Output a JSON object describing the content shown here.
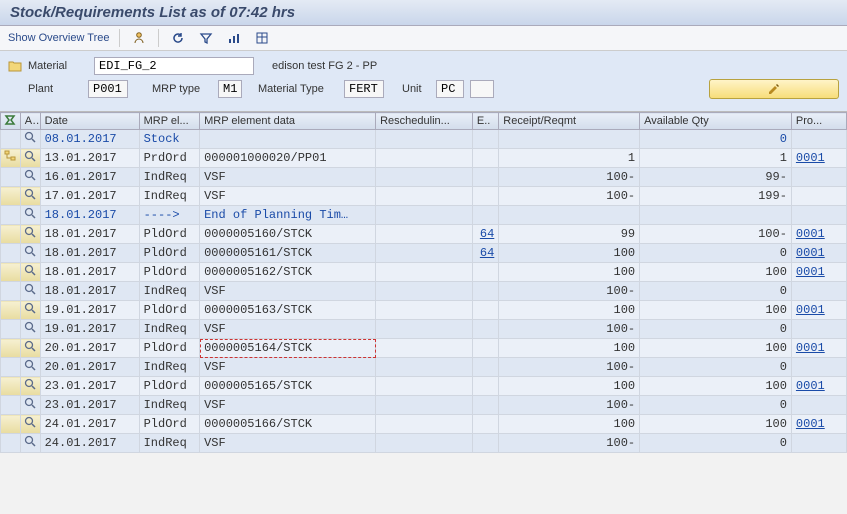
{
  "title": "Stock/Requirements List as of 07:42 hrs",
  "toolbar": {
    "overview": "Show Overview Tree"
  },
  "header": {
    "material_label": "Material",
    "material_value": "EDI_FG_2",
    "material_desc": "edison test FG 2 - PP",
    "plant_label": "Plant",
    "plant_value": "P001",
    "mrp_type_label": "MRP type",
    "mrp_type_value": "M1",
    "mat_type_label": "Material Type",
    "mat_type_value": "FERT",
    "unit_label": "Unit",
    "unit_value": "PC"
  },
  "columns": {
    "side": "",
    "act": "A..",
    "date": "Date",
    "el": "MRP el...",
    "eldata": "MRP element data",
    "res": "Reschedulin...",
    "e": "E..",
    "rec": "Receipt/Reqmt",
    "avail": "Available Qty",
    "pro": "Pro..."
  },
  "rows": [
    {
      "date": "08.01.2017",
      "el": "Stock",
      "eldata": "",
      "res": "",
      "e": "",
      "rec": "",
      "avail": "0",
      "pro": "",
      "blue": true
    },
    {
      "date": "13.01.2017",
      "el": "PrdOrd",
      "eldata": "000001000020/PP01",
      "res": "",
      "e": "",
      "rec": "1",
      "avail": "1",
      "pro": "0001",
      "elink": false
    },
    {
      "date": "16.01.2017",
      "el": "IndReq",
      "eldata": "VSF",
      "res": "",
      "e": "",
      "rec": "100-",
      "avail": "99-",
      "pro": ""
    },
    {
      "date": "17.01.2017",
      "el": "IndReq",
      "eldata": "VSF",
      "res": "",
      "e": "",
      "rec": "100-",
      "avail": "199-",
      "pro": ""
    },
    {
      "date": "18.01.2017",
      "el": "---->",
      "eldata": "End of Planning Tim…",
      "res": "",
      "e": "",
      "rec": "",
      "avail": "",
      "pro": "",
      "blue": true
    },
    {
      "date": "18.01.2017",
      "el": "PldOrd",
      "eldata": "0000005160/STCK",
      "res": "",
      "e": "64",
      "rec": "99",
      "avail": "100-",
      "pro": "0001",
      "elink": true
    },
    {
      "date": "18.01.2017",
      "el": "PldOrd",
      "eldata": "0000005161/STCK",
      "res": "",
      "e": "64",
      "rec": "100",
      "avail": "0",
      "pro": "0001",
      "elink": true
    },
    {
      "date": "18.01.2017",
      "el": "PldOrd",
      "eldata": "0000005162/STCK",
      "res": "",
      "e": "",
      "rec": "100",
      "avail": "100",
      "pro": "0001"
    },
    {
      "date": "18.01.2017",
      "el": "IndReq",
      "eldata": "VSF",
      "res": "",
      "e": "",
      "rec": "100-",
      "avail": "0",
      "pro": ""
    },
    {
      "date": "19.01.2017",
      "el": "PldOrd",
      "eldata": "0000005163/STCK",
      "res": "",
      "e": "",
      "rec": "100",
      "avail": "100",
      "pro": "0001"
    },
    {
      "date": "19.01.2017",
      "el": "IndReq",
      "eldata": "VSF",
      "res": "",
      "e": "",
      "rec": "100-",
      "avail": "0",
      "pro": ""
    },
    {
      "date": "20.01.2017",
      "el": "PldOrd",
      "eldata": "0000005164/STCK",
      "res": "",
      "e": "",
      "rec": "100",
      "avail": "100",
      "pro": "0001",
      "selected": true
    },
    {
      "date": "20.01.2017",
      "el": "IndReq",
      "eldata": "VSF",
      "res": "",
      "e": "",
      "rec": "100-",
      "avail": "0",
      "pro": ""
    },
    {
      "date": "23.01.2017",
      "el": "PldOrd",
      "eldata": "0000005165/STCK",
      "res": "",
      "e": "",
      "rec": "100",
      "avail": "100",
      "pro": "0001"
    },
    {
      "date": "23.01.2017",
      "el": "IndReq",
      "eldata": "VSF",
      "res": "",
      "e": "",
      "rec": "100-",
      "avail": "0",
      "pro": ""
    },
    {
      "date": "24.01.2017",
      "el": "PldOrd",
      "eldata": "0000005166/STCK",
      "res": "",
      "e": "",
      "rec": "100",
      "avail": "100",
      "pro": "0001"
    },
    {
      "date": "24.01.2017",
      "el": "IndReq",
      "eldata": "VSF",
      "res": "",
      "e": "",
      "rec": "100-",
      "avail": "0",
      "pro": ""
    }
  ]
}
